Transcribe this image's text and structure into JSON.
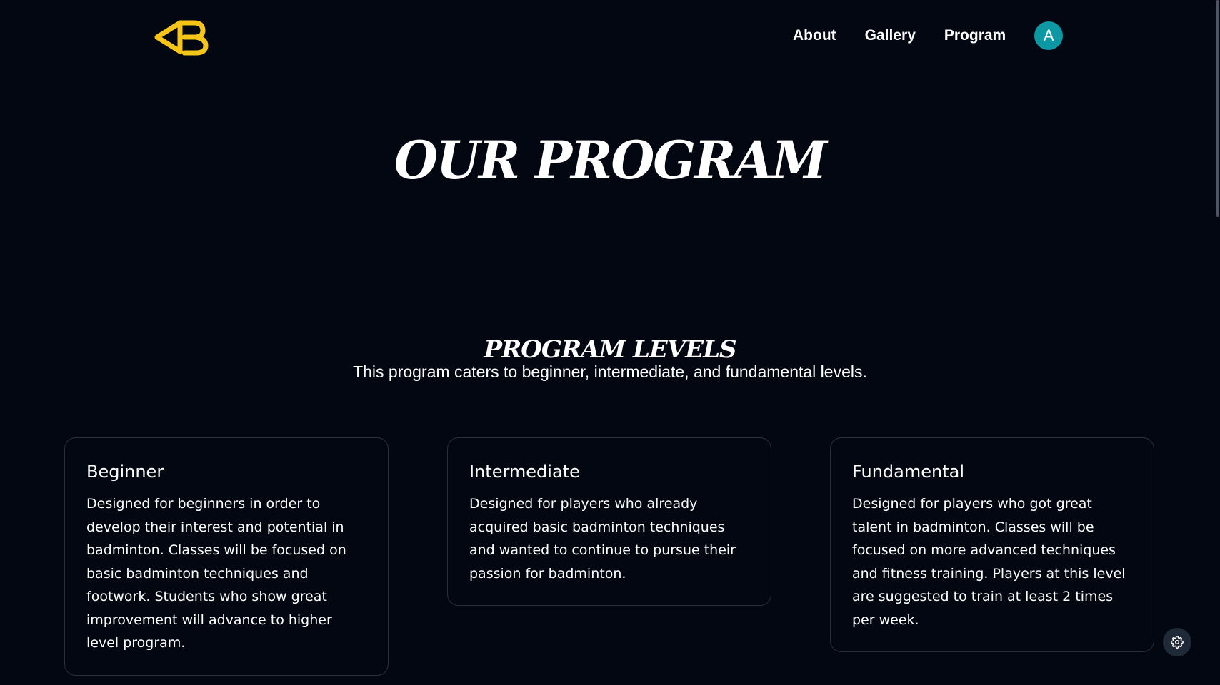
{
  "header": {
    "logo": {
      "icon": "ab-logo-icon",
      "color": "#f5c518"
    },
    "nav": [
      {
        "label": "About"
      },
      {
        "label": "Gallery"
      },
      {
        "label": "Program"
      }
    ],
    "avatar": {
      "initial": "A",
      "color": "#0e98a3"
    }
  },
  "hero": {
    "title": "OUR PROGRAM"
  },
  "levels": {
    "title": "PROGRAM LEVELS",
    "subtitle": "This program caters to beginner, intermediate, and fundamental levels.",
    "cards": [
      {
        "title": "Beginner",
        "body": "Designed for beginners in order to develop their interest and potential in badminton. Classes will be focused on basic badminton techniques and footwork. Students who show great improvement will advance to higher level program."
      },
      {
        "title": "Intermediate",
        "body": "Designed for players who already acquired basic badminton techniques and wanted to continue to pursue their passion for badminton."
      },
      {
        "title": "Fundamental",
        "body": "Designed for players who got great talent in badminton. Classes will be focused on more advanced techniques and fitness training. Players at this level are suggested to train at least 2 times per week."
      }
    ]
  },
  "settings": {
    "icon": "gear-icon"
  }
}
